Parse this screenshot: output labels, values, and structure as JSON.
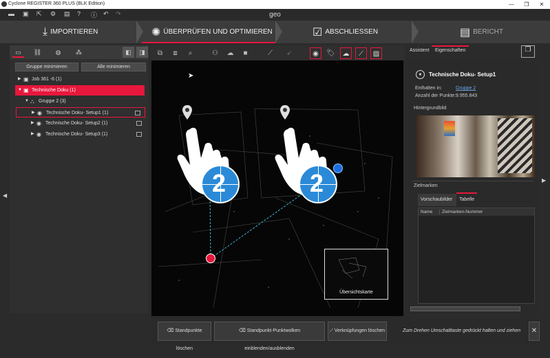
{
  "window": {
    "title": "Cyclone REGISTER 360 PLUS (BLK Edition)",
    "project_name": "geo",
    "minimize": "—",
    "maximize": "❐",
    "close": "✕"
  },
  "workflow_steps": [
    {
      "label": "IMPORTIEREN",
      "icon": "import-icon",
      "active": false
    },
    {
      "label": "ÜBERPRÜFEN UND OPTIMIEREN",
      "icon": "review-icon",
      "active": true
    },
    {
      "label": "ABSCHLIESSEN",
      "icon": "finalize-icon",
      "active": false
    },
    {
      "label": "BERICHT",
      "icon": "report-icon",
      "active": false
    }
  ],
  "left_panel": {
    "collapse_group_label": "Gruppe minimieren",
    "collapse_all_label": "Alle minimieren",
    "tree": [
      {
        "label": "Job 361 -6 (1)",
        "level": 0
      },
      {
        "label": "Technische Doku (1)",
        "level": 0,
        "selected": true
      },
      {
        "label": "Gruppe 2 (3)",
        "level": 1
      },
      {
        "label": "Technische Doku- Setup1 (1)",
        "level": 2,
        "highlighted": true
      },
      {
        "label": "Technische Doku- Setup2 (1)",
        "level": 2
      },
      {
        "label": "Technische Doku- Setup3 (1)",
        "level": 2
      }
    ]
  },
  "viewport": {
    "overview_label": "Übersichtskarte",
    "markers": [
      "2",
      "2"
    ]
  },
  "bottom_bar": {
    "delete_setups_label": "Standpunkte löschen",
    "toggle_clouds_label": "Standpunkt-Punktwolken einblenden/ausblenden",
    "delete_links_label": "Verknüpfungen löschen",
    "hint": "Zum Drehen Umschalttaste gedrückt halten und ziehen",
    "close": "✕"
  },
  "right_panel": {
    "tab_assistant": "Assistent",
    "tab_properties": "Eigenschaften",
    "setup_title": "Technische Doku- Setup1",
    "contained_in_label": "Enthalten in:",
    "contained_in_value": "Gruppe 2",
    "point_count_label": "Anzahl der Punkte:",
    "point_count_value": "9.955.843",
    "background_image_label": "Hintergrundbild",
    "targets_label": "Zielmarken",
    "preview_tab": "Vorschaubilder",
    "table_tab": "Tabelle",
    "col_name": "Name",
    "col_target_number": "Zielmarken-Nummer"
  },
  "colors": {
    "accent": "#e8173c",
    "link": "#6aa8e8",
    "marker_blue": "#2a8ad8",
    "link_line": "#3fb8d8"
  }
}
